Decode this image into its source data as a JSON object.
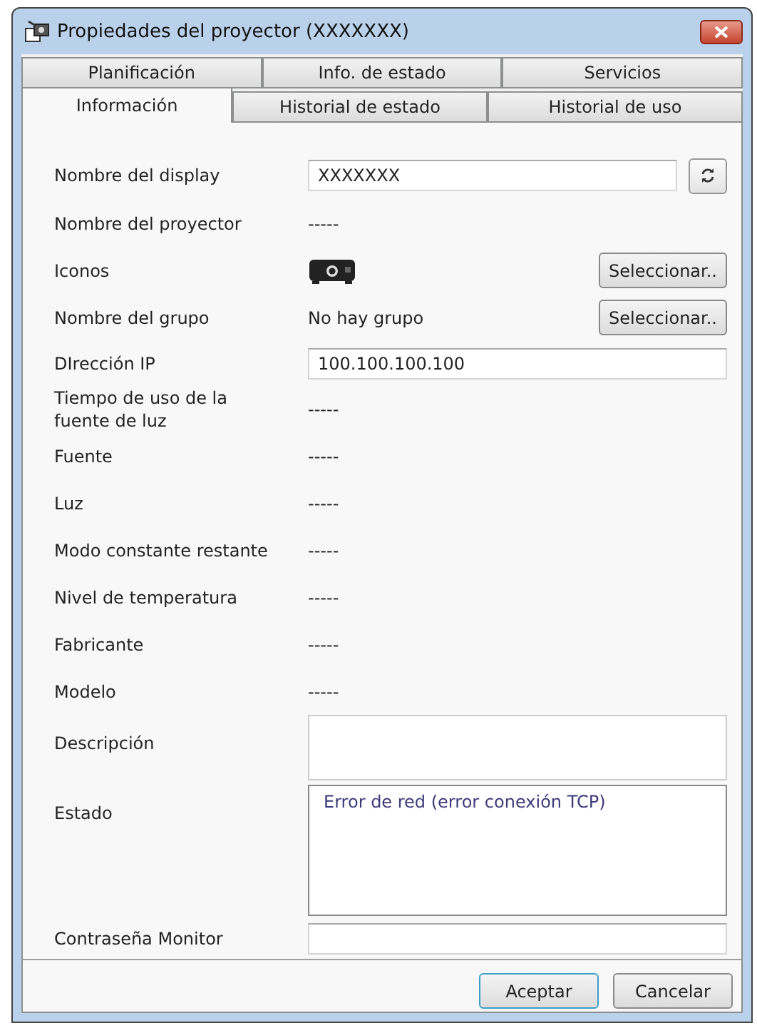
{
  "window": {
    "title": "Propiedades del proyector (XXXXXXX)"
  },
  "tab_rows": [
    [
      {
        "label": "Planificación",
        "selected": false
      },
      {
        "label": "Info. de estado",
        "selected": false
      },
      {
        "label": "Servicios",
        "selected": false
      }
    ],
    [
      {
        "label": "Información",
        "selected": true
      },
      {
        "label": "Historial de estado",
        "selected": false
      },
      {
        "label": "Historial de uso",
        "selected": false
      }
    ]
  ],
  "rows": [
    {
      "kind": "field_refresh",
      "label": "Nombre del display",
      "value": "XXXXXXX"
    },
    {
      "kind": "text",
      "label": "Nombre del proyector",
      "value": "-----"
    },
    {
      "kind": "icon_button",
      "label": "Iconos",
      "button": "Seleccionar.."
    },
    {
      "kind": "text_button",
      "label": "Nombre del grupo",
      "value": "No hay grupo",
      "button": "Seleccionar.."
    },
    {
      "kind": "field",
      "label": "DIrección IP",
      "value": "100.100.100.100"
    },
    {
      "kind": "text",
      "label": "Tiempo de uso de la fuente de luz",
      "value": "-----"
    },
    {
      "kind": "text",
      "label": "Fuente",
      "value": "-----"
    },
    {
      "kind": "text",
      "label": "Luz",
      "value": "-----"
    },
    {
      "kind": "text",
      "label": "Modo constante restante",
      "value": "-----"
    },
    {
      "kind": "text",
      "label": "Nivel de temperatura",
      "value": "-----"
    },
    {
      "kind": "text",
      "label": "Fabricante",
      "value": "-----"
    },
    {
      "kind": "text",
      "label": "Modelo",
      "value": "-----"
    },
    {
      "kind": "multiline",
      "label": "Descripción",
      "value": ""
    },
    {
      "kind": "status",
      "label": "Estado",
      "value": "Error de red (error conexión TCP)"
    },
    {
      "kind": "field",
      "label": "Contraseña Monitor",
      "value": ""
    }
  ],
  "buttons": [
    {
      "label": "Aceptar",
      "default": true
    },
    {
      "label": "Cancelar",
      "default": false
    }
  ]
}
